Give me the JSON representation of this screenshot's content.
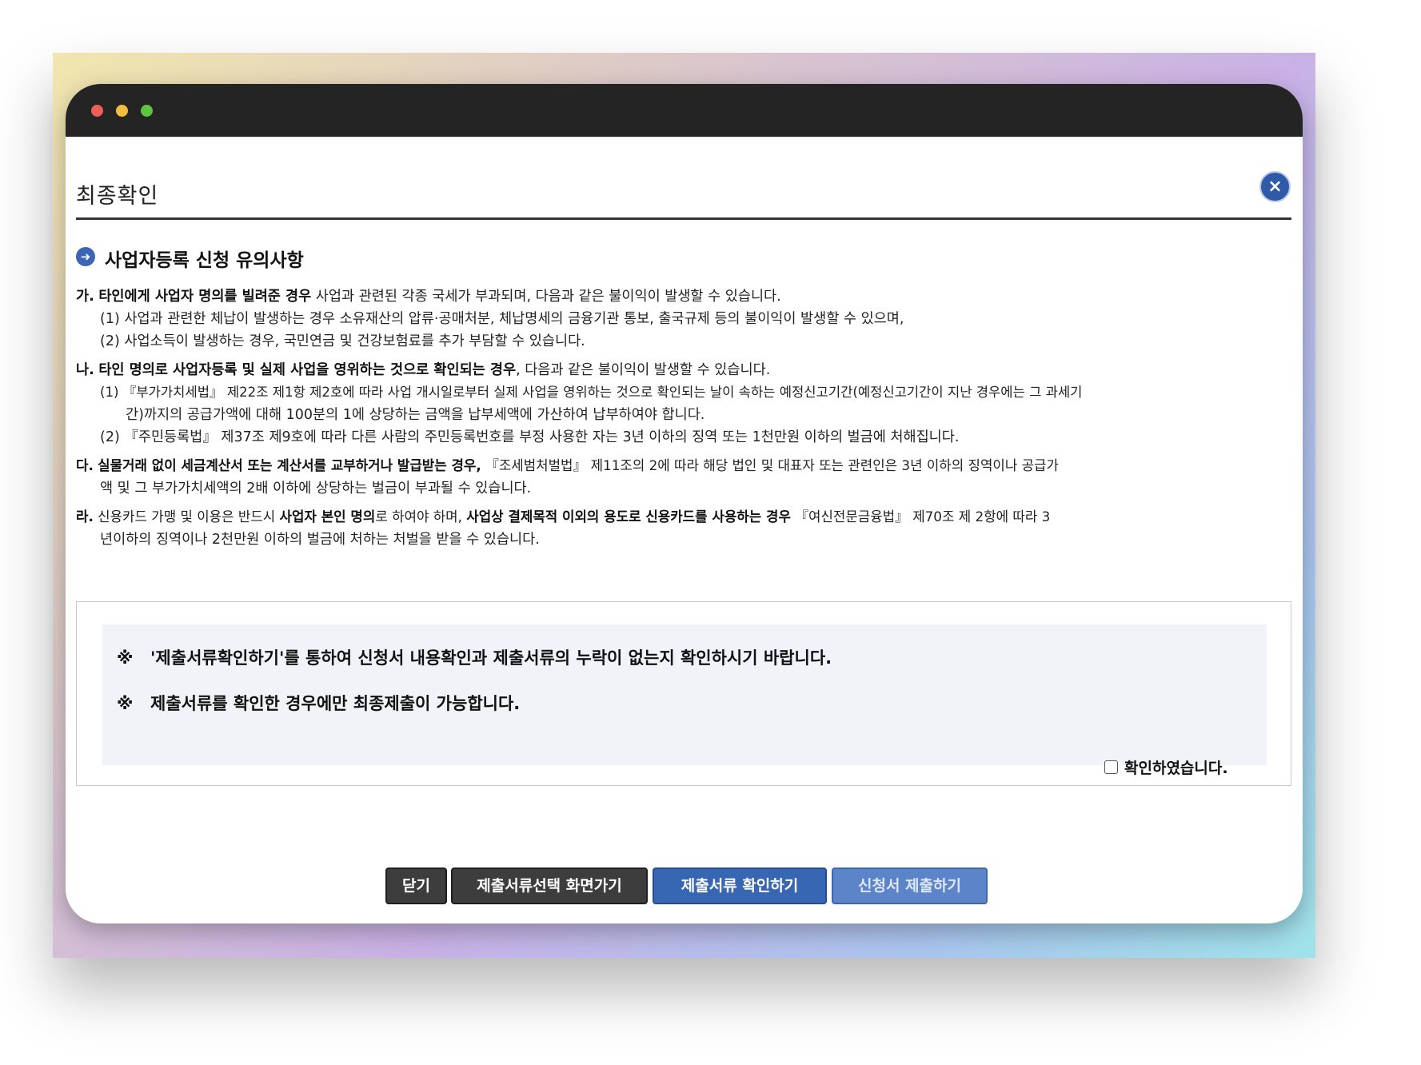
{
  "dialog": {
    "title": "최종확인",
    "close_label": "×"
  },
  "section": {
    "title": "사업자등록 신청 유의사항"
  },
  "notes": [
    {
      "marker": "가.",
      "lines": [
        {
          "bold": "타인에게 사업자 명의를 빌려준 경우",
          "rest": " 사업과 관련된 각종 국세가 부과되며, 다음과 같은 불이익이 발생할 수 있습니다."
        },
        {
          "bold": "",
          "rest": "(1) 사업과 관련한 체납이 발생하는 경우 소유재산의 압류·공매처분, 체납명세의 금융기관 통보, 출국규제 등의 불이익이 발생할 수 있으며,"
        },
        {
          "bold": "",
          "rest": "(2) 사업소득이 발생하는 경우, 국민연금 및 건강보험료를 추가 부담할 수 있습니다."
        }
      ]
    },
    {
      "marker": "나.",
      "lines": [
        {
          "bold": "타인 명의로 사업자등록 및 실제 사업을 영위하는 것으로 확인되는 경우",
          "rest": ", 다음과 같은 불이익이 발생할 수 있습니다."
        },
        {
          "bold": "",
          "rest": "(1) 『부가가치세법』 제22조 제1항 제2호에 따라 사업 개시일로부터 실제 사업을 영위하는 것으로 확인되는 날이 속하는 예정신고기간(예정신고기간이 지난 경우에는 그 과세기"
        },
        {
          "bold": "",
          "rest": "간)까지의 공급가액에 대해 100분의 1에 상당하는 금액을 납부세액에 가산하여 납부하여야 합니다."
        },
        {
          "bold": "",
          "rest": "(2) 『주민등록법』 제37조 제9호에 따라 다른 사람의 주민등록번호를 부정 사용한 자는 3년 이하의 징역 또는 1천만원 이하의 벌금에 처해집니다."
        }
      ]
    },
    {
      "marker": "다.",
      "lines": [
        {
          "bold": "실물거래 없이 세금계산서 또는 계산서를 교부하거나 발급받는 경우,",
          "rest": " 『조세범처벌법』 제11조의 2에 따라 해당 법인 및 대표자 또는 관련인은 3년 이하의 징역이나 공급가"
        },
        {
          "bold": "",
          "rest": "액 및 그 부가가치세액의 2배 이하에 상당하는 벌금이 부과될 수 있습니다."
        }
      ]
    },
    {
      "marker": "라.",
      "lines": [
        {
          "pre": " 신용카드 가맹 및 이용은 반드시 ",
          "bold": "사업자 본인 명의",
          "mid": "로 하여야 하며, ",
          "bold2": "사업상 결제목적 이외의 용도로 신용카드를 사용하는 경우",
          "rest": " 『여신전문금융법』 제70조 제 2항에 따라 3"
        },
        {
          "bold": "",
          "rest": "년이하의 징역이나 2천만원 이하의 벌금에 처하는 처벌을 받을 수 있습니다."
        }
      ]
    }
  ],
  "confirm": {
    "mark": "※",
    "line1": "'제출서류확인하기'를 통하여 신청서 내용확인과 제출서류의 누락이 없는지 확인하시기 바랍니다.",
    "line2": "제출서류를 확인한 경우에만 최종제출이 가능합니다.",
    "checkbox_label": "확인하였습니다.",
    "checked": false
  },
  "buttons": {
    "close": "닫기",
    "goto_select": "제출서류선택 화면가기",
    "check_docs": "제출서류 확인하기",
    "submit": "신청서 제출하기"
  },
  "colors": {
    "accent": "#3766b2",
    "titlebar": "#242424"
  }
}
